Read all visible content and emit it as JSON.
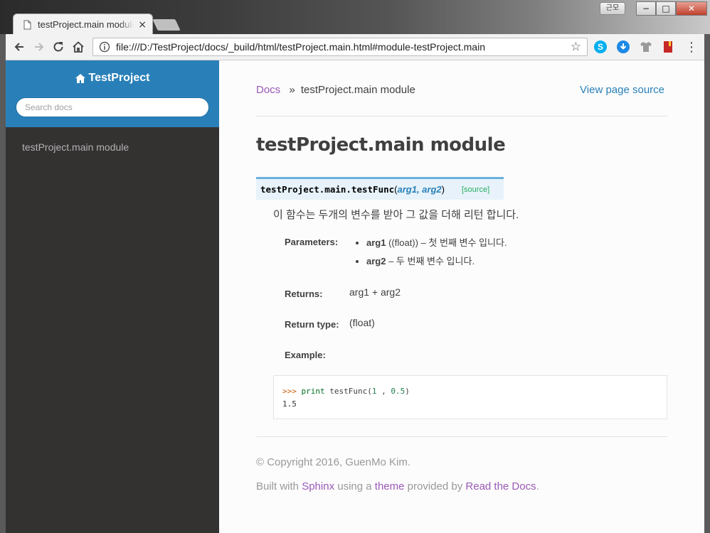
{
  "window": {
    "owner_label": "근모",
    "minimize": "−",
    "maximize": "□",
    "close": "✕"
  },
  "tab": {
    "title": "testProject.main module",
    "close": "×"
  },
  "toolbar": {
    "url": "file:///D:/TestProject/docs/_build/html/testProject.main.html#module-testProject.main",
    "star": "☆",
    "menu": "⋮"
  },
  "sidebar": {
    "brand": "TestProject",
    "search_placeholder": "Search docs",
    "items": [
      {
        "label": "testProject.main module"
      }
    ]
  },
  "breadcrumbs": {
    "docs": "Docs",
    "separator": "»",
    "current": "testProject.main module",
    "view_source": "View page source"
  },
  "page": {
    "title": "testProject.main module",
    "signature": {
      "name": "testProject.main.testFunc",
      "open_paren": "(",
      "args": "arg1, arg2",
      "close_paren": ")",
      "source_link": "[source]"
    },
    "description": "이 함수는 두개의 변수를 받아 그 값을 더해 리턴 합니다.",
    "fields": {
      "parameters_label": "Parameters:",
      "params": [
        {
          "name": "arg1",
          "type": " ((float)) – 첫 번째 변수 입니다."
        },
        {
          "name": "arg2",
          "type": " – 두 번째 변수 입니다."
        }
      ],
      "returns_label": "Returns:",
      "returns_value": "arg1 + arg2",
      "return_type_label": "Return type:",
      "return_type_value": "(float)",
      "example_label": "Example:"
    },
    "code": {
      "prompt": ">>>",
      "keyword": "print",
      "call": "testFunc(",
      "arg1": "1",
      "comma": " , ",
      "arg2": "0.5",
      "close": ")",
      "output": "1.5"
    }
  },
  "footer": {
    "copyright": "© Copyright 2016, GuenMo Kim.",
    "built_prefix": "Built with ",
    "sphinx": "Sphinx",
    "using_a": " using a ",
    "theme": "theme",
    "provided_by": " provided by ",
    "rtd": "Read the Docs",
    "period": "."
  },
  "colors": {
    "sidebar_bg": "#343131",
    "sidebar_top": "#2980b9",
    "link": "#2980b9",
    "visited": "#9b59b6",
    "signature_bg": "#e7f2fa",
    "signature_border": "#6ab0de",
    "source_link": "#27ae60"
  },
  "icons": {
    "back": "arrow-left-icon",
    "forward": "arrow-right-icon",
    "reload": "reload-icon",
    "home": "home-icon",
    "info": "info-icon",
    "star": "star-icon",
    "skype": "skype-icon",
    "download": "download-icon",
    "shirt": "shirt-icon",
    "bookmark": "bookmark-icon",
    "menu": "menu-icon"
  }
}
